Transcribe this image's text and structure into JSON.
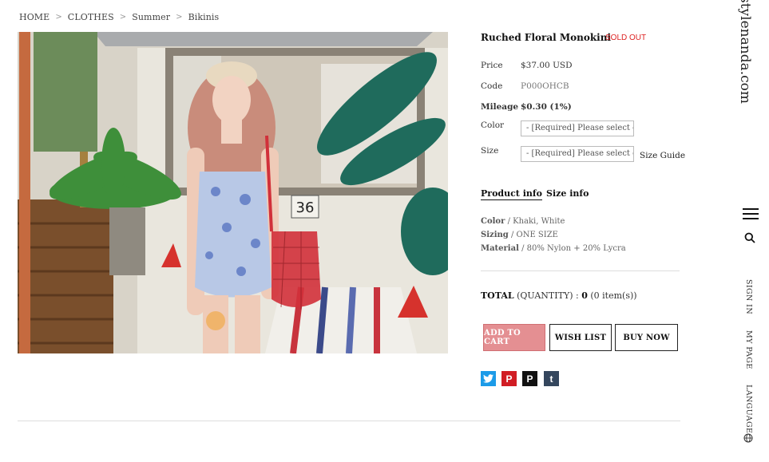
{
  "breadcrumb": [
    "HOME",
    "CLOTHES",
    "Summer",
    "Bikinis"
  ],
  "product": {
    "name": "Ruched Floral Monokini",
    "status": "SOLD OUT",
    "price_label": "Price",
    "price": "$37.00 USD",
    "code_label": "Code",
    "code": "P000OHCB",
    "mileage_label": "Mileage",
    "mileage": "$0.30 (1%)",
    "color_label": "Color",
    "color_select": "- [Required] Please select opt",
    "size_label": "Size",
    "size_select": "- [Required] Please select opt",
    "size_guide": "Size Guide"
  },
  "tabs": [
    "Product info",
    "Size info"
  ],
  "info": [
    {
      "label": "Color",
      "value": "/ Khaki, White"
    },
    {
      "label": "Sizing",
      "value": "/ ONE SIZE"
    },
    {
      "label": "Material",
      "value": "/ 80% Nylon + 20% Lycra"
    }
  ],
  "total": {
    "label": "TOTAL",
    "qty_text": "(QUANTITY) :",
    "qty": "0",
    "items": "(0 item(s))"
  },
  "buttons": {
    "cart": "ADD TO CART",
    "wishlist": "WISH LIST",
    "buy": "BUY NOW"
  },
  "social": [
    {
      "icon": "twitter-icon",
      "glyph": "t",
      "color": "#1c9be8"
    },
    {
      "icon": "pinterest-icon",
      "glyph": "P",
      "color": "#d11d24"
    },
    {
      "icon": "polyvore-icon",
      "glyph": "P",
      "color": "#111111"
    },
    {
      "icon": "tumblr-icon",
      "glyph": "t",
      "color": "#34465d"
    }
  ],
  "rail": {
    "brand": "stylenanda.com",
    "signin": "SIGN IN",
    "mypage": "MY PAGE",
    "language": "LANGUAGE"
  },
  "photo": {
    "sign_number": "36"
  },
  "colors": {
    "accent": "#e48f92",
    "soldout": "#dd2222"
  }
}
